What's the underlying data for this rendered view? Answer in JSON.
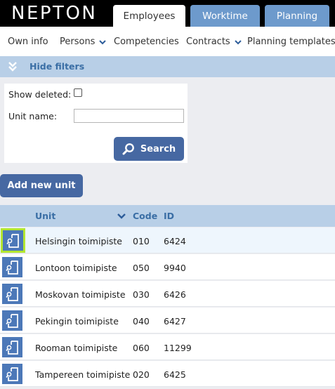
{
  "app": {
    "logo": "NEPTON"
  },
  "tabs": [
    {
      "label": "Employees",
      "active": true
    },
    {
      "label": "Worktime",
      "active": false
    },
    {
      "label": "Planning",
      "active": false
    }
  ],
  "subnav": {
    "own_info": "Own info",
    "persons": "Persons",
    "competencies": "Competencies",
    "contracts": "Contracts",
    "planning_templates": "Planning templates"
  },
  "filters": {
    "toggle_label": "Hide filters",
    "show_deleted_label": "Show deleted:",
    "show_deleted_checked": false,
    "unit_name_label": "Unit name:",
    "unit_name_value": "",
    "search_label": "Search"
  },
  "actions": {
    "add_new_unit": "Add new unit"
  },
  "table": {
    "columns": {
      "unit": "Unit",
      "code": "Code",
      "id": "ID"
    },
    "rows": [
      {
        "unit": "Helsingin toimipiste",
        "code": "010",
        "id": "6424",
        "selected": true
      },
      {
        "unit": "Lontoon toimipiste",
        "code": "050",
        "id": "9940",
        "selected": false
      },
      {
        "unit": "Moskovan toimipiste",
        "code": "030",
        "id": "6426",
        "selected": false
      },
      {
        "unit": "Pekingin toimipiste",
        "code": "040",
        "id": "6427",
        "selected": false
      },
      {
        "unit": "Rooman toimipiste",
        "code": "060",
        "id": "11299",
        "selected": false
      },
      {
        "unit": "Tampereen toimipiste",
        "code": "020",
        "id": "6425",
        "selected": false
      }
    ]
  },
  "colors": {
    "brand_blue": "#4668a2",
    "header_blue": "#b8cfe7",
    "tab_inactive": "#6d9acc",
    "selection_outline": "#b3e630",
    "link_text": "#3a6ea5"
  },
  "icons": {
    "row_action": "edit-document-icon",
    "search": "magnifier-icon",
    "filter_toggle": "double-chevron-down-icon",
    "sort": "chevron-down-icon",
    "menu_dropdown": "chevron-down-icon"
  }
}
